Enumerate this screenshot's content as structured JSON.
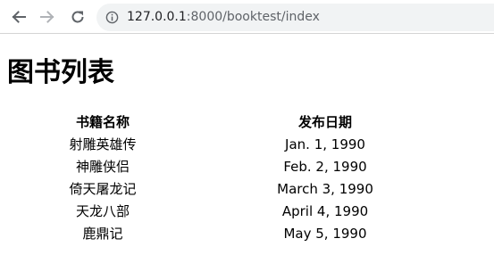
{
  "browser": {
    "url_host": "127.0.0.1",
    "url_rest": ":8000/booktest/index",
    "back_icon": "arrow-left-icon",
    "forward_icon": "arrow-right-icon",
    "reload_icon": "reload-icon",
    "site_info_icon": "info-circle-icon"
  },
  "page": {
    "title": "图书列表"
  },
  "table": {
    "headers": [
      "书籍名称",
      "发布日期"
    ],
    "rows": [
      {
        "name": "射雕英雄传",
        "date": "Jan. 1, 1990"
      },
      {
        "name": "神雕侠侣",
        "date": "Feb. 2, 1990"
      },
      {
        "name": "倚天屠龙记",
        "date": "March 3, 1990"
      },
      {
        "name": "天龙八部",
        "date": "April 4, 1990"
      },
      {
        "name": "鹿鼎记",
        "date": "May 5, 1990"
      }
    ]
  },
  "colors": {
    "toolbar_bg": "#ffffff",
    "omnibox_bg": "#f1f3f4",
    "icon_active": "#5f6368",
    "icon_disabled": "#b0b3b7"
  }
}
